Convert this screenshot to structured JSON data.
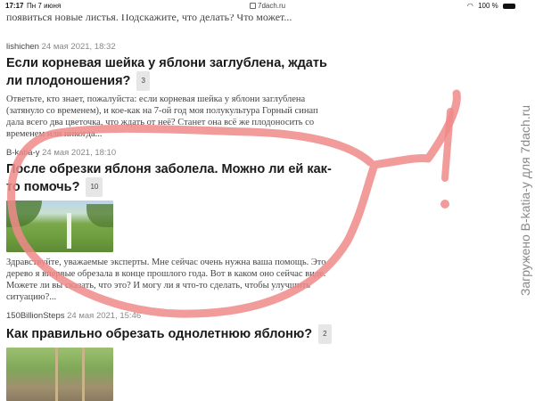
{
  "status_bar": {
    "time": "17:17",
    "date": "Пн 7 июня",
    "url": "7dach.ru",
    "battery": "100 %"
  },
  "cut_off_text": "появиться новые листья. Подскажите, что делать? Что может...",
  "posts": [
    {
      "author": "lishichen",
      "date": "24 мая 2021, 18:32",
      "title": "Если корневая шейка у яблони заглублена, ждать ли плодоношения?",
      "count": "3",
      "excerpt": "Ответьте, кто знает, пожалуйста: если корневая шейка у яблони заглублена (затянуло со временем), и кое-как на 7-ой год моя полукультура Горный синап дала всего два цветочка, что ждать от неё? Станет она всё же плодоносить со временем или никогда..."
    },
    {
      "author": "B-katia-y",
      "date": "24 мая 2021, 18:10",
      "title": "После обрезки яблоня заболела. Можно ли ей как-то помочь?",
      "count": "10",
      "excerpt": "Здравствуйте, уважаемые эксперты. Мне сейчас очень нужна ваша помощь. Это дерево я впервые обрезала в конце прошлого года. Вот в каком оно сейчас виде. Можете ли вы сказать, что это? И могу ли я что-то сделать, чтобы улучшить ситуацию?..."
    },
    {
      "author": "150BillionSteps",
      "date": "24 мая 2021, 15:46",
      "title": "Как правильно обрезать однолетнюю яблоню?",
      "count": "2"
    }
  ],
  "watermark": "Загружено B-katia-y для 7dach.ru",
  "colors": {
    "annotation": "#f08a8a",
    "meta": "#888888",
    "badge_bg": "#e6e6e6"
  }
}
